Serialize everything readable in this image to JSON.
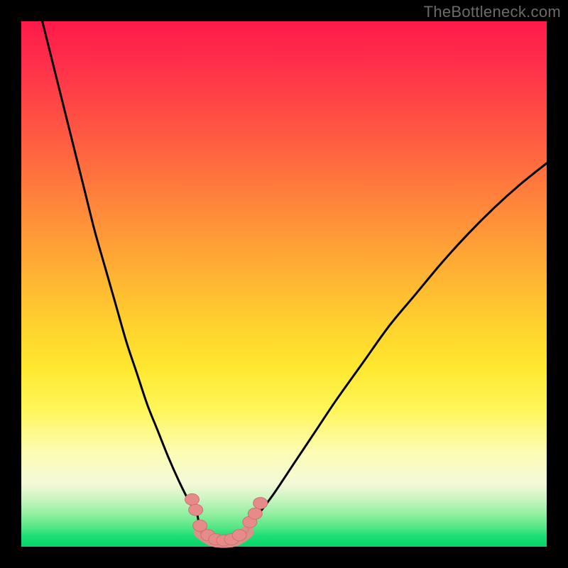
{
  "watermark": "TheBottleneck.com",
  "colors": {
    "frame": "#000000",
    "curve": "#000000",
    "marker_fill": "#e68a8a",
    "marker_stroke": "#d07070",
    "gradient_top": "#ff1a4b",
    "gradient_bottom": "#08d56a"
  },
  "chart_data": {
    "type": "line",
    "title": "",
    "xlabel": "",
    "ylabel": "",
    "xlim": [
      0,
      100
    ],
    "ylim": [
      0,
      100
    ],
    "note": "V-shaped bottleneck curve; y≈0 (green) is optimal, y→100 (red) is severe bottleneck. Minimum near x≈37.",
    "series": [
      {
        "name": "left-branch",
        "x": [
          4,
          6,
          8,
          10,
          12,
          14,
          16,
          18,
          20,
          22,
          24,
          26,
          28,
          30,
          32,
          33.5,
          35,
          36.5,
          37.5
        ],
        "y": [
          100,
          92,
          84,
          76,
          68,
          60,
          53,
          46,
          39,
          33,
          27,
          22,
          17,
          12.5,
          8.5,
          6,
          4,
          2.3,
          1.4
        ]
      },
      {
        "name": "right-branch",
        "x": [
          40.5,
          42,
          43.5,
          45,
          48,
          52,
          56,
          60,
          65,
          70,
          75,
          80,
          85,
          90,
          95,
          100
        ],
        "y": [
          1.4,
          2.3,
          4,
          6,
          10,
          16,
          22,
          28,
          35,
          42,
          48,
          54,
          59.5,
          64.5,
          69,
          73
        ]
      },
      {
        "name": "valley-floor",
        "x": [
          34,
          35,
          36,
          37,
          38,
          39,
          40,
          41,
          42,
          43
        ],
        "y": [
          2.8,
          2.0,
          1.4,
          1.1,
          1.0,
          1.0,
          1.1,
          1.4,
          2.0,
          2.8
        ]
      }
    ],
    "markers": [
      {
        "x": 32.5,
        "y": 9.0
      },
      {
        "x": 33.2,
        "y": 7.0
      },
      {
        "x": 34.0,
        "y": 4.0
      },
      {
        "x": 35.5,
        "y": 2.2
      },
      {
        "x": 37.0,
        "y": 1.4
      },
      {
        "x": 38.5,
        "y": 1.2
      },
      {
        "x": 40.0,
        "y": 1.4
      },
      {
        "x": 41.5,
        "y": 2.2
      },
      {
        "x": 43.5,
        "y": 4.7
      },
      {
        "x": 44.5,
        "y": 6.3
      },
      {
        "x": 45.5,
        "y": 8.3
      }
    ]
  }
}
